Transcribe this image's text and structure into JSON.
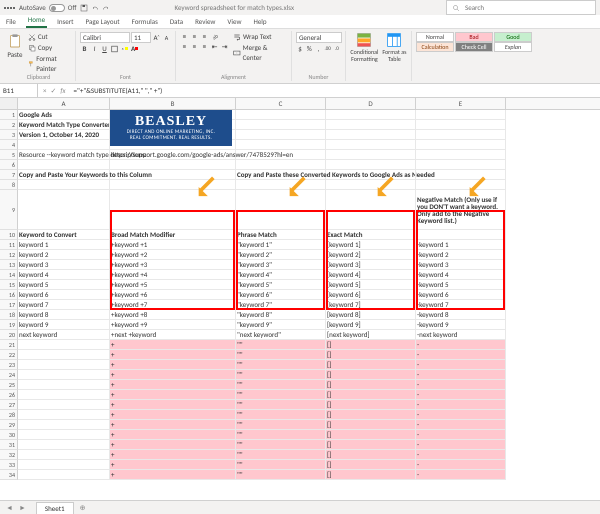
{
  "titlebar": {
    "autosave_label": "AutoSave",
    "autosave_state": "Off",
    "filename": "Keyword spreadsheet for match types.xlsx",
    "search_placeholder": "Search"
  },
  "tabs": [
    "File",
    "Home",
    "Insert",
    "Page Layout",
    "Formulas",
    "Data",
    "Review",
    "View",
    "Help"
  ],
  "active_tab": 1,
  "ribbon": {
    "clipboard": {
      "paste": "Paste",
      "cut": "Cut",
      "copy": "Copy",
      "format_painter": "Format Painter",
      "label": "Clipboard"
    },
    "font": {
      "name": "Calibri",
      "size": "11",
      "label": "Font",
      "bold": "B",
      "italic": "I",
      "underline": "U",
      "inc": "A",
      "dec": "A"
    },
    "alignment": {
      "wrap": "Wrap Text",
      "merge": "Merge & Center",
      "label": "Alignment"
    },
    "number": {
      "format": "General",
      "label": "Number"
    },
    "cond": {
      "conditional": "Conditional Formatting",
      "format_table": "Format as Table",
      "label": ""
    },
    "styles": {
      "normal": "Normal",
      "bad": "Bad",
      "good": "Good",
      "calculation": "Calculation",
      "check": "Check Cell",
      "explan": "Explan"
    }
  },
  "formula": {
    "name_box": "B11",
    "formula": "=\"+\"&SUBSTITUTE(A11,\" \",\" +\")"
  },
  "columns": [
    "A",
    "B",
    "C",
    "D",
    "E"
  ],
  "header_rows": {
    "1": {
      "A": "Google Ads"
    },
    "2": {
      "A": "Keyword Match Type Converter"
    },
    "3": {
      "A": "Version 1, October 14, 2020"
    },
    "5": {
      "A": "Resource --keyword match type descriptions:",
      "B": "https://support.google.com/google-ads/answer/7478529?hl=en"
    },
    "7": {
      "A": "Copy and Paste Your Keywords to this Column",
      "C": "Copy and Paste these Converted Keywords to Google Ads as Needed"
    },
    "9": {
      "E": "Negative Match (Only use if you DON'T want a keyword. Only add to the Negative Keyword list.)"
    },
    "10": {
      "A": "Keyword to Convert",
      "B": "Broad Match Modifier",
      "C": "Phrase Match",
      "D": "Exact Match"
    }
  },
  "data_rows": [
    {
      "n": 11,
      "A": "keyword 1",
      "B": "+keyword +1",
      "C": "\"keyword 1\"",
      "D": "[keyword 1]",
      "E": "-keyword 1"
    },
    {
      "n": 12,
      "A": "keyword 2",
      "B": "+keyword +2",
      "C": "\"keyword 2\"",
      "D": "[keyword 2]",
      "E": "-keyword 2"
    },
    {
      "n": 13,
      "A": "keyword 3",
      "B": "+keyword +3",
      "C": "\"keyword 3\"",
      "D": "[keyword 3]",
      "E": "-keyword 3"
    },
    {
      "n": 14,
      "A": "keyword 4",
      "B": "+keyword +4",
      "C": "\"keyword 4\"",
      "D": "[keyword 4]",
      "E": "-keyword 4"
    },
    {
      "n": 15,
      "A": "keyword 5",
      "B": "+keyword +5",
      "C": "\"keyword 5\"",
      "D": "[keyword 5]",
      "E": "-keyword 5"
    },
    {
      "n": 16,
      "A": "keyword 6",
      "B": "+keyword +6",
      "C": "\"keyword 6\"",
      "D": "[keyword 6]",
      "E": "-keyword 6"
    },
    {
      "n": 17,
      "A": "keyword 7",
      "B": "+keyword +7",
      "C": "\"keyword 7\"",
      "D": "[keyword 7]",
      "E": "-keyword 7"
    },
    {
      "n": 18,
      "A": "keyword 8",
      "B": "+keyword +8",
      "C": "\"keyword 8\"",
      "D": "[keyword 8]",
      "E": "-keyword 8"
    },
    {
      "n": 19,
      "A": "keyword 9",
      "B": "+keyword +9",
      "C": "\"keyword 9\"",
      "D": "[keyword 9]",
      "E": "-keyword 9"
    },
    {
      "n": 20,
      "A": "next keyword",
      "B": "+next +keyword",
      "C": "\"next keyword\"",
      "D": "[next keyword]",
      "E": "-next keyword"
    }
  ],
  "empty_rows": [
    {
      "n": 21,
      "B": "+",
      "C": "\"\"",
      "D": "[]",
      "E": "-"
    },
    {
      "n": 22,
      "B": "+",
      "C": "\"\"",
      "D": "[]",
      "E": "-"
    },
    {
      "n": 23,
      "B": "+",
      "C": "\"\"",
      "D": "[]",
      "E": "-"
    },
    {
      "n": 24,
      "B": "+",
      "C": "\"\"",
      "D": "[]",
      "E": "-"
    },
    {
      "n": 25,
      "B": "+",
      "C": "\"\"",
      "D": "[]",
      "E": "-"
    },
    {
      "n": 26,
      "B": "+",
      "C": "\"\"",
      "D": "[]",
      "E": "-"
    },
    {
      "n": 27,
      "B": "+",
      "C": "\"\"",
      "D": "[]",
      "E": "-"
    },
    {
      "n": 28,
      "B": "+",
      "C": "\"\"",
      "D": "[]",
      "E": "-"
    },
    {
      "n": 29,
      "B": "+",
      "C": "\"\"",
      "D": "[]",
      "E": "-"
    },
    {
      "n": 30,
      "B": "+",
      "C": "\"\"",
      "D": "[]",
      "E": "-"
    },
    {
      "n": 31,
      "B": "+",
      "C": "\"\"",
      "D": "[]",
      "E": "-"
    },
    {
      "n": 32,
      "B": "+",
      "C": "\"\"",
      "D": "[]",
      "E": "-"
    },
    {
      "n": 33,
      "B": "+",
      "C": "\"\"",
      "D": "[]",
      "E": "-"
    },
    {
      "n": 34,
      "B": "+",
      "C": "\"\"",
      "D": "[]",
      "E": "-"
    }
  ],
  "logo": {
    "main": "BEASLEY",
    "sub1": "DIRECT AND ONLINE MARKETING, INC.",
    "sub2": "REAL COMMITMENT. REAL RESULTS."
  },
  "sheet_tab": "Sheet1"
}
